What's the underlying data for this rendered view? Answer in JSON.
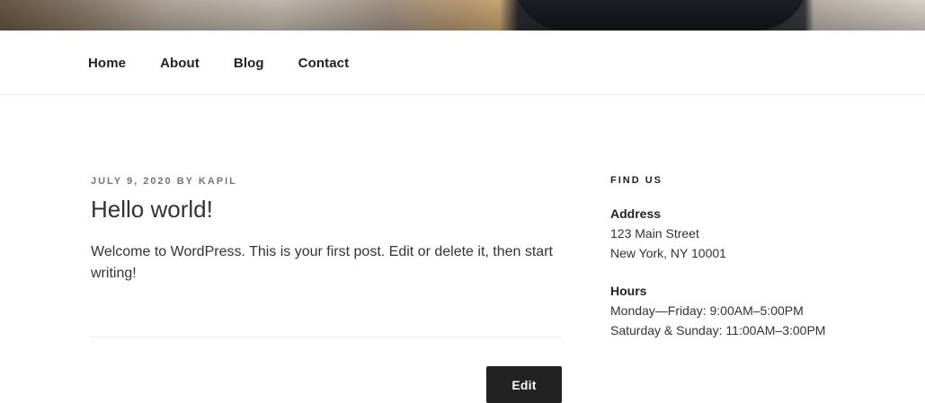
{
  "nav": {
    "items": [
      {
        "label": "Home"
      },
      {
        "label": "About"
      },
      {
        "label": "Blog"
      },
      {
        "label": "Contact"
      }
    ]
  },
  "post": {
    "date": "July 9, 2020",
    "by": "by",
    "author": "Kapil",
    "title": "Hello world!",
    "content": "Welcome to WordPress. This is your first post. Edit or delete it, then start writing!",
    "edit_label": "Edit"
  },
  "sidebar": {
    "widget_title": "Find Us",
    "address": {
      "title": "Address",
      "line1": "123 Main Street",
      "line2": "New York, NY 10001"
    },
    "hours": {
      "title": "Hours",
      "line1": "Monday—Friday: 9:00AM–5:00PM",
      "line2": "Saturday & Sunday: 11:00AM–3:00PM"
    }
  }
}
